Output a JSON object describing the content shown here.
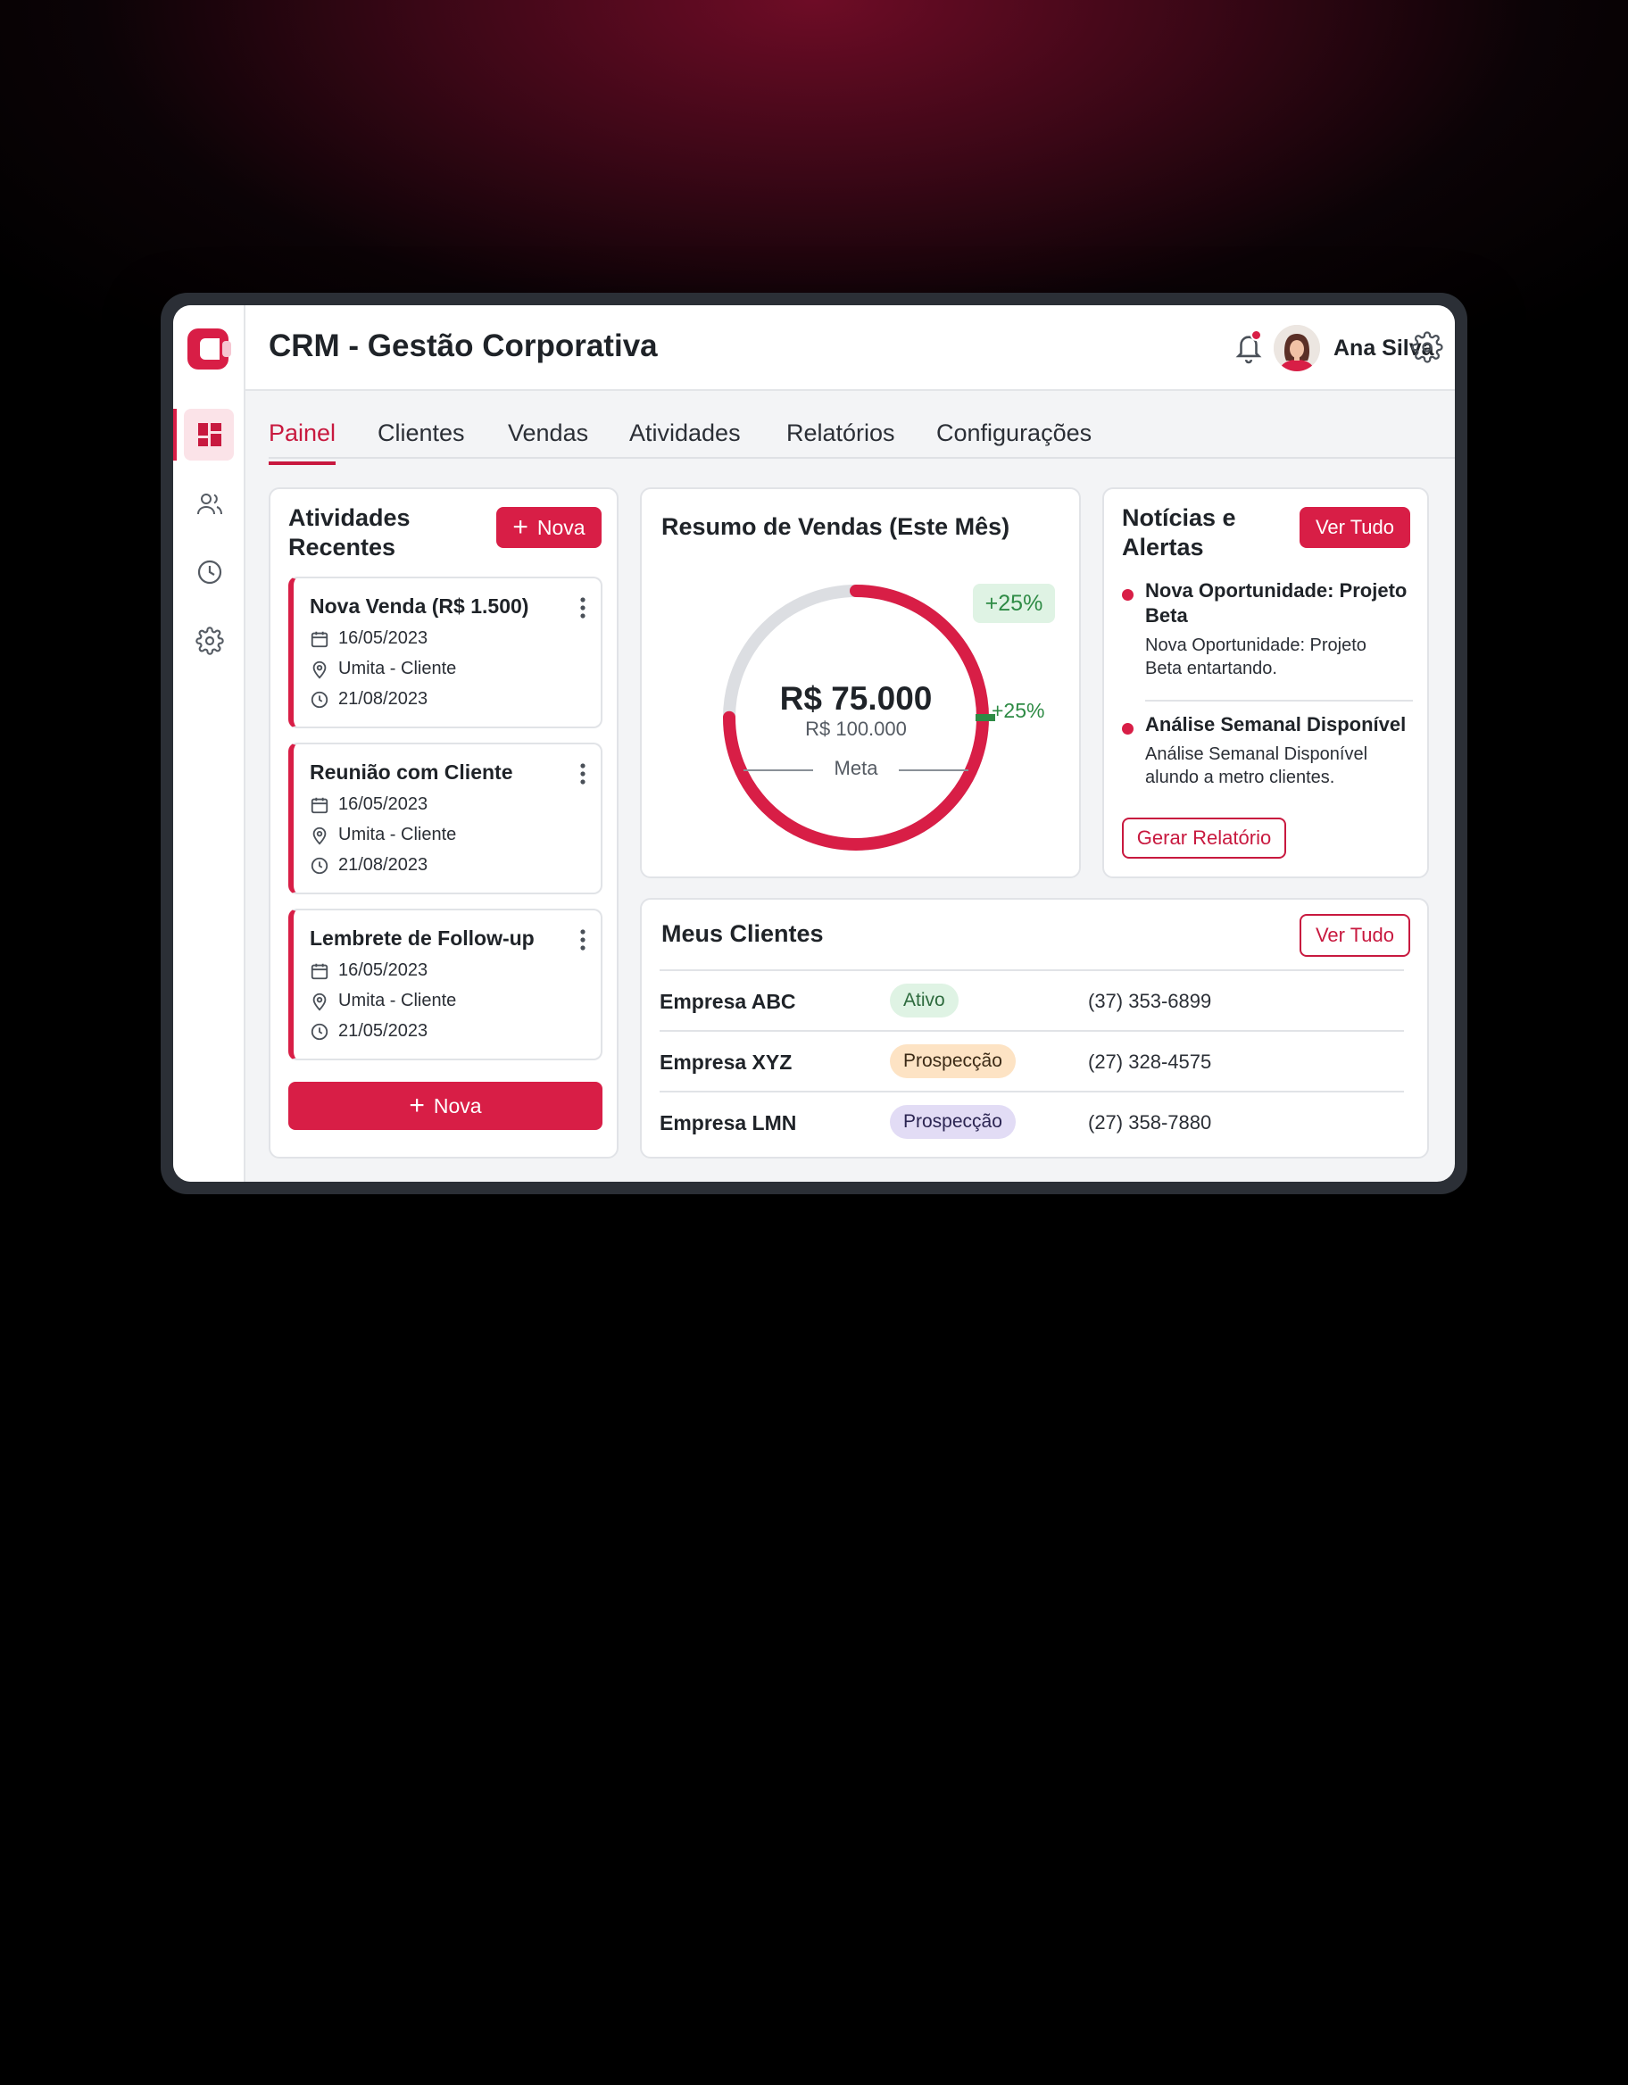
{
  "header": {
    "title": "CRM - Gestão Corporativa",
    "user_name": "Ana Silva"
  },
  "sidebar": {
    "items": [
      {
        "icon": "dashboard-icon",
        "active": true
      },
      {
        "icon": "users-icon",
        "active": false
      },
      {
        "icon": "clock-icon",
        "active": false
      },
      {
        "icon": "gear-icon",
        "active": false
      }
    ]
  },
  "tabs": [
    {
      "label": "Painel",
      "active": true
    },
    {
      "label": "Clientes",
      "active": false
    },
    {
      "label": "Vendas",
      "active": false
    },
    {
      "label": "Atividades",
      "active": false
    },
    {
      "label": "Relatórios",
      "active": false
    },
    {
      "label": "Configurações",
      "active": false
    }
  ],
  "activities": {
    "title": "Atividades Recentes",
    "new_label": "Nova",
    "items": [
      {
        "title": "Nova Venda (R$ 1.500)",
        "date": "16/05/2023",
        "location": "Umita - Cliente",
        "due": "21/08/2023"
      },
      {
        "title": "Reunião com Cliente",
        "date": "16/05/2023",
        "location": "Umita - Cliente",
        "due": "21/08/2023"
      },
      {
        "title": "Lembrete de Follow-up",
        "date": "16/05/2023",
        "location": "Umita - Cliente",
        "due": "21/05/2023"
      }
    ],
    "bottom_new_label": "Nova"
  },
  "sales_summary": {
    "title": "Resumo de Vendas (Este Mês)",
    "value": "R$ 75.000",
    "goal": "R$ 100.000",
    "goal_label": "Meta",
    "progress": 0.75,
    "badge": "+25%",
    "side_pct": "+25%"
  },
  "news": {
    "title": "Notícias e Alertas",
    "see_all_label": "Ver Tudo",
    "items": [
      {
        "title": "Nova Oportunidade: Projeto Beta",
        "body": "Nova Oportunidade: Projeto Beta entartando."
      },
      {
        "title": "Análise Semanal Disponível",
        "body": "Análise Semanal Disponível alundo a metro clientes."
      }
    ],
    "report_label": "Gerar Relatório"
  },
  "clients": {
    "title": "Meus Clientes",
    "see_all_label": "Ver Tudo",
    "rows": [
      {
        "name": "Empresa ABC",
        "status": "Ativo",
        "phone": "(37) 353-6899"
      },
      {
        "name": "Empresa XYZ",
        "status": "Prospecção",
        "phone": "(27) 328-4575"
      },
      {
        "name": "Empresa LMN",
        "status": "Prospecção",
        "phone": "(27) 358-7880"
      }
    ]
  },
  "colors": {
    "accent": "#d81e46",
    "status_active_bg": "#dff3e4",
    "status_prospect_orange_bg": "#fde3c4",
    "status_prospect_purple_bg": "#e2dcf5"
  }
}
